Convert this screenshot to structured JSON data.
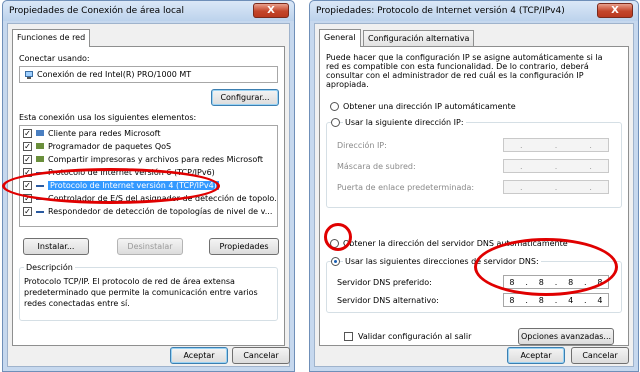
{
  "left": {
    "title": "Propiedades de Conexión de área local",
    "close": "X",
    "tab": "Funciones de red",
    "connect_label": "Conectar usando:",
    "adapter": "Conexión de red Intel(R) PRO/1000 MT",
    "configure": "Configurar...",
    "list_label": "Esta conexión usa los siguientes elementos:",
    "items": [
      {
        "label": "Cliente para redes Microsoft",
        "checked": true
      },
      {
        "label": "Programador de paquetes QoS",
        "checked": true
      },
      {
        "label": "Compartir impresoras y archivos para redes Microsoft",
        "checked": true
      },
      {
        "label": "Protocolo de Internet versión 6 (TCP/IPv6)",
        "checked": true
      },
      {
        "label": "Protocolo de Internet versión 4 (TCP/IPv4)",
        "checked": true,
        "selected": true
      },
      {
        "label": "Controlador de E/S del asignador de detección de topolo...",
        "checked": true
      },
      {
        "label": "Respondedor de detección de topologías de nivel de v...",
        "checked": true
      }
    ],
    "install": "Instalar...",
    "uninstall": "Desinstalar",
    "properties": "Propiedades",
    "description_label": "Descripción",
    "description": [
      "Protocolo TCP/IP. El protocolo de red de área extensa",
      "predeterminado que permite la comunicación entre varios",
      "redes conectadas entre sí."
    ],
    "ok": "Aceptar",
    "cancel": "Cancelar"
  },
  "right": {
    "title": "Propiedades: Protocolo de Internet versión 4 (TCP/IPv4)",
    "close": "X",
    "tab_general": "General",
    "tab_alt": "Configuración alternativa",
    "intro": [
      "Puede hacer que la configuración IP se asigne automáticamente si la",
      "red es compatible con esta funcionalidad. De lo contrario, deberá",
      "consultar con el administrador de red cuál es la configuración IP",
      "apropiada."
    ],
    "auto_ip": "Obtener una dirección IP automáticamente",
    "use_ip": "Usar la siguiente dirección IP:",
    "ip_address": "Dirección IP:",
    "subnet": "Máscara de subred:",
    "gateway": "Puerta de enlace predeterminada:",
    "auto_dns": "Obtener la dirección del servidor DNS automáticamente",
    "use_dns": "Usar las siguientes direcciones de servidor DNS:",
    "preferred_dns_label": "Servidor DNS preferido:",
    "alternate_dns_label": "Servidor DNS alternativo:",
    "preferred_dns": [
      "8",
      "8",
      "8",
      "8"
    ],
    "alternate_dns": [
      "8",
      "8",
      "4",
      "4"
    ],
    "validate": "Validar configuración al salir",
    "advanced": "Opciones avanzadas...",
    "ok": "Aceptar",
    "cancel": "Cancelar"
  },
  "annotation_color": "#e00000"
}
